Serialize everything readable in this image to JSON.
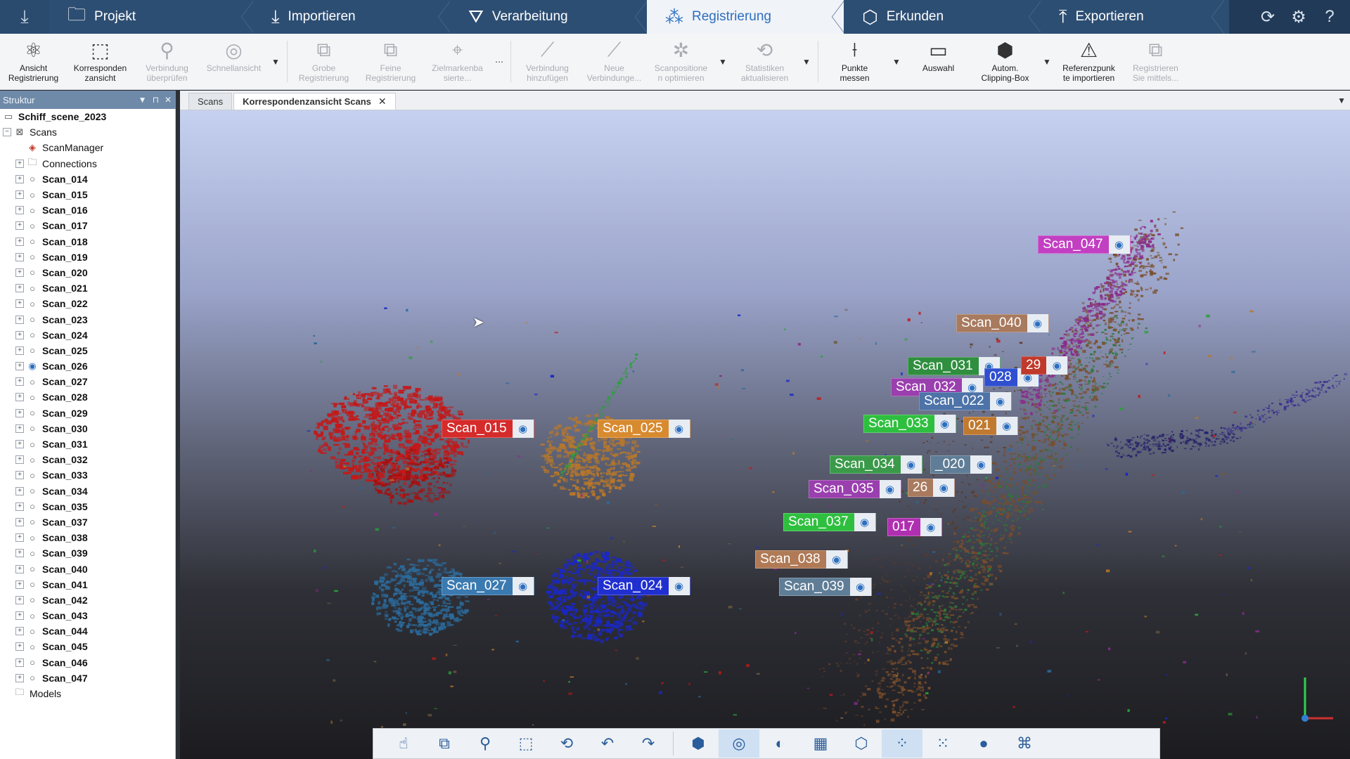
{
  "app": {
    "tabs": [
      {
        "label": "Projekt",
        "icon": "folder-icon",
        "glyph": "🗀"
      },
      {
        "label": "Importieren",
        "icon": "import-icon",
        "glyph": "⤓"
      },
      {
        "label": "Verarbeitung",
        "icon": "filter-icon",
        "glyph": "⛛"
      },
      {
        "label": "Registrierung",
        "icon": "registration-icon",
        "glyph": "⁂"
      },
      {
        "label": "Erkunden",
        "icon": "explore-icon",
        "glyph": "⬡"
      },
      {
        "label": "Exportieren",
        "icon": "export-icon",
        "glyph": "⤒"
      }
    ],
    "active_tab": "Registrierung"
  },
  "ribbon": {
    "buttons": [
      {
        "label": "Ansicht\nRegistrierung",
        "icon": "registration-view-icon",
        "glyph": "⚛",
        "enabled": true
      },
      {
        "label": "Korresponden\nzansicht",
        "icon": "correspondence-view-icon",
        "glyph": "⬚",
        "enabled": true
      },
      {
        "label": "Verbindung\nüberprüfen",
        "icon": "check-connection-icon",
        "glyph": "⚲",
        "enabled": false
      },
      {
        "label": "Schnellansicht",
        "icon": "quick-view-icon",
        "glyph": "◎",
        "enabled": false
      },
      {
        "label": "Grobe\nRegistrierung",
        "icon": "coarse-registration-icon",
        "glyph": "⧉",
        "enabled": false
      },
      {
        "label": "Feine\nRegistrierung",
        "icon": "fine-registration-icon",
        "glyph": "⧉",
        "enabled": false
      },
      {
        "label": "Zielmarkenba\nsierte...",
        "icon": "target-based-icon",
        "glyph": "⌖",
        "enabled": false
      },
      {
        "label": "Verbindung\nhinzufügen",
        "icon": "add-connection-icon",
        "glyph": "⟋",
        "enabled": false
      },
      {
        "label": "Neue\nVerbindunge...",
        "icon": "new-connections-icon",
        "glyph": "⟋",
        "enabled": false
      },
      {
        "label": "Scanpositione\nn optimieren",
        "icon": "optimize-positions-icon",
        "glyph": "✲",
        "enabled": false
      },
      {
        "label": "Statistiken\naktualisieren",
        "icon": "update-statistics-icon",
        "glyph": "⟲",
        "enabled": false
      },
      {
        "label": "Punkte\nmessen",
        "icon": "measure-points-icon",
        "glyph": "⟊",
        "enabled": true
      },
      {
        "label": "Auswahl",
        "icon": "selection-icon",
        "glyph": "▭",
        "enabled": true
      },
      {
        "label": "Autom.\nClipping-Box",
        "icon": "clipping-box-icon",
        "glyph": "⬢",
        "enabled": true
      },
      {
        "label": "Referenzpunk\nte importieren",
        "icon": "import-reference-icon",
        "glyph": "⚠",
        "enabled": true
      },
      {
        "label": "Registrieren\nSie mittels...",
        "icon": "register-via-icon",
        "glyph": "⧉",
        "enabled": false
      }
    ]
  },
  "structure": {
    "title": "Struktur",
    "project": "Schiff_scene_2023",
    "scans_label": "Scans",
    "scan_manager": "ScanManager",
    "connections": "Connections",
    "models": "Models",
    "scans": [
      "Scan_014",
      "Scan_015",
      "Scan_016",
      "Scan_017",
      "Scan_018",
      "Scan_019",
      "Scan_020",
      "Scan_021",
      "Scan_022",
      "Scan_023",
      "Scan_024",
      "Scan_025",
      "Scan_026",
      "Scan_027",
      "Scan_028",
      "Scan_029",
      "Scan_030",
      "Scan_031",
      "Scan_032",
      "Scan_033",
      "Scan_034",
      "Scan_035",
      "Scan_037",
      "Scan_038",
      "Scan_039",
      "Scan_040",
      "Scan_041",
      "Scan_042",
      "Scan_043",
      "Scan_044",
      "Scan_045",
      "Scan_046",
      "Scan_047"
    ]
  },
  "doc_tabs": {
    "inactive": "Scans",
    "active": "Korrespondenzansicht Scans"
  },
  "viewport": {
    "labels": [
      {
        "text": "Scan_047",
        "color": "#c23fc2"
      },
      {
        "text": "Scan_040",
        "color": "#a87a5e"
      },
      {
        "text": "Scan_031",
        "color": "#2f8f3f"
      },
      {
        "text": "Scan_032",
        "color": "#9a3fae"
      },
      {
        "text": "Scan_022",
        "color": "#4d73a8"
      },
      {
        "text": "Scan_033",
        "color": "#2fbf3f"
      },
      {
        "text": "021",
        "color": "#c07a2f"
      },
      {
        "text": "Scan_034",
        "color": "#3a9a4a"
      },
      {
        "text": "_020",
        "color": "#5f7d96"
      },
      {
        "text": "Scan_035",
        "color": "#9a3fae"
      },
      {
        "text": "26",
        "color": "#a87a5e"
      },
      {
        "text": "Scan_037",
        "color": "#2fbf3f"
      },
      {
        "text": "017",
        "color": "#b02fb0"
      },
      {
        "text": "Scan_038",
        "color": "#b07a56"
      },
      {
        "text": "Scan_039",
        "color": "#5f7d96"
      },
      {
        "text": "Scan_015",
        "color": "#d52b2b"
      },
      {
        "text": "Scan_025",
        "color": "#d88a2f"
      },
      {
        "text": "Scan_027",
        "color": "#3a7ab0"
      },
      {
        "text": "Scan_024",
        "color": "#1f2fd0"
      },
      {
        "text": "028",
        "color": "#2f4fd0"
      },
      {
        "text": "29",
        "color": "#c0392b"
      }
    ]
  },
  "viewbar": {
    "buttons": [
      {
        "name": "navigation-mode-icon",
        "glyph": "☝",
        "active": false
      },
      {
        "name": "view-perspective-icon",
        "glyph": "⧉",
        "active": false
      },
      {
        "name": "zoom-icon",
        "glyph": "⚲",
        "active": false
      },
      {
        "name": "view-cube-icon",
        "glyph": "⬚",
        "active": false
      },
      {
        "name": "rotate-icon",
        "glyph": "⟲",
        "active": false
      },
      {
        "name": "undo-view-icon",
        "glyph": "↶",
        "active": false
      },
      {
        "name": "redo-view-icon",
        "glyph": "↷",
        "active": false
      },
      {
        "name": "box-view-icon",
        "glyph": "⬢",
        "active": false
      },
      {
        "name": "sphere-view-icon",
        "glyph": "◎",
        "active": true
      },
      {
        "name": "clip-plane-icon",
        "glyph": "◐",
        "active": false
      },
      {
        "name": "grid-icon",
        "glyph": "▦",
        "active": false
      },
      {
        "name": "hexagon-icon",
        "glyph": "⬡",
        "active": false
      },
      {
        "name": "point-density-icon",
        "glyph": "⁘",
        "active": true
      },
      {
        "name": "point-size-icon",
        "glyph": "⁙",
        "active": false
      },
      {
        "name": "color-mode-icon",
        "glyph": "●",
        "active": false
      },
      {
        "name": "layer-icon",
        "glyph": "⌘",
        "active": false
      }
    ]
  }
}
